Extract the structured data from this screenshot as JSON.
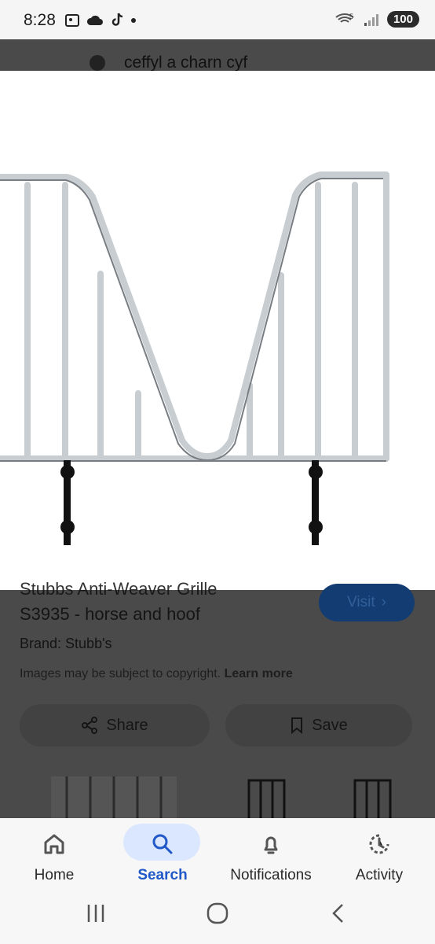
{
  "status": {
    "time": "8:28",
    "battery": "100",
    "network_badge": "5"
  },
  "search": {
    "query": "ceffyl a charn cyf"
  },
  "result": {
    "title": "Stubbs Anti-Weaver Grille",
    "subtitle": "S3935 - horse and hoof",
    "brand": "Brand: Stubb's",
    "copyright_text": "Images may be subject to copyright.",
    "learn_more": "Learn more",
    "visit_label": "Visit",
    "share_label": "Share",
    "save_label": "Save"
  },
  "bottom_nav": {
    "items": [
      {
        "label": "Home"
      },
      {
        "label": "Search"
      },
      {
        "label": "Notifications"
      },
      {
        "label": "Activity"
      }
    ],
    "active": "Search"
  },
  "icons": {
    "status": [
      "image-icon",
      "cloud-icon",
      "tiktok-icon",
      "dot-icon"
    ],
    "status_right": [
      "wifi-5-icon",
      "signal-icon"
    ],
    "nav": [
      "home-icon",
      "search-icon",
      "bell-icon",
      "activity-icon"
    ],
    "system": [
      "recents-icon",
      "home-circle-icon",
      "back-icon"
    ]
  },
  "colors": {
    "active_tab": "#2058c7",
    "active_pill": "#dbe7ff",
    "visit_button": "#123c72",
    "background_dim": "#3a3a3a"
  }
}
